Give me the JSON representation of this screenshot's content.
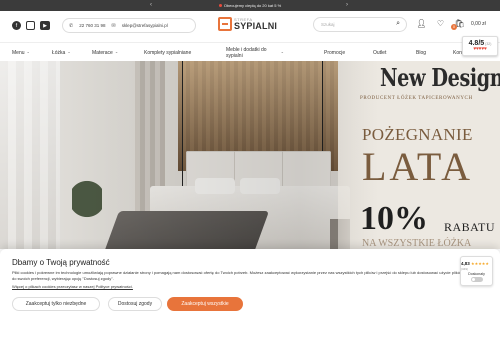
{
  "promo_bar": {
    "text": "Obecujemy ciepłą do 20 kat 5 %",
    "prev_icon": "chevron-left-icon",
    "next_icon": "chevron-right-icon",
    "dot_color": "#e94b3c"
  },
  "header": {
    "socials": [
      {
        "name": "facebook-icon",
        "glyph": "f"
      },
      {
        "name": "instagram-icon",
        "glyph": "◎"
      },
      {
        "name": "youtube-icon",
        "glyph": "▶"
      }
    ],
    "phone": "22 760 31 98",
    "email": "sklep@strefasypialni.pl",
    "logo_small": "STREFA",
    "logo_big": "SYPIALNI",
    "search_placeholder": "Szukaj",
    "cart_count": "0",
    "cart_total": "0,00 zł",
    "accent_color": "#e8743b"
  },
  "nav": {
    "items": [
      {
        "label": "Menu",
        "chevron": "⌄"
      },
      {
        "label": "Łóżka",
        "chevron": "⌄"
      },
      {
        "label": "Materace",
        "chevron": "⌄"
      },
      {
        "label": "Komplety sypialniane",
        "chevron": ""
      },
      {
        "label": "Meble i dodatki do sypialni",
        "chevron": "⌄"
      },
      {
        "label": "Promocje",
        "chevron": ""
      },
      {
        "label": "Outlet",
        "chevron": ""
      },
      {
        "label": "Blog",
        "chevron": ""
      },
      {
        "label": "Kontakt",
        "chevron": ""
      }
    ]
  },
  "rating_badge": {
    "score": "4.8/5",
    "count": "(32)",
    "hearts": "♥♥♥♥♥"
  },
  "hero": {
    "title": "New Design",
    "subtitle": "PRODUCENT ŁÓŻEK TAPICEROWANYCH",
    "farewell": "POŻEGNANIE",
    "season": "LATA",
    "percent": "10%",
    "discount_word": "RABATU",
    "all_beds": "NA WSZYSTKIE ŁÓŻKA"
  },
  "cookie": {
    "title": "Dbamy o Twoją prywatność",
    "body": "Pliki cookies i pokrewne im technologie umożliwiają poprawne działanie strony i pomagają nam dostosować ofertę do Twoich potrzeb. Możesz zaakceptować wykorzystanie przez nas wszystkich tych plików i przejść do sklepu lub dostosować użycie plików do swoich preferencji, wybierając opcję \"Dostosuj zgody\".",
    "link": "Więcej o plikach cookies przeczytasz w naszej Polityce prywatności.",
    "btn_necessary": "Zaakceptuj tylko niezbędne",
    "btn_customize": "Dostosuj zgody",
    "btn_accept_all": "Zaakceptuj wszystkie",
    "trust_score": "4,83",
    "trust_stars": "★★★★★",
    "trust_count": "(349)",
    "trust_label": "Doskonały"
  }
}
